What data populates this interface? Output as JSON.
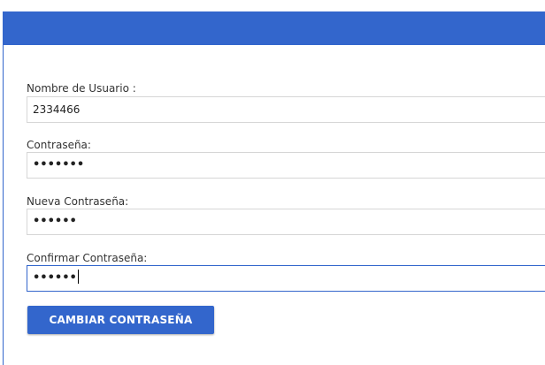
{
  "form": {
    "username_label": "Nombre de Usuario :",
    "username_value": "2334466",
    "password_label": "Contraseña:",
    "password_mask": "•••••••",
    "new_password_label": "Nueva Contraseña:",
    "new_password_mask": "••••••",
    "confirm_password_label": "Confirmar Contraseña:",
    "confirm_password_mask": "••••••",
    "submit_label": "CAMBIAR CONTRASEÑA"
  },
  "colors": {
    "primary": "#3366cc",
    "input_border": "#d6d6d6"
  }
}
